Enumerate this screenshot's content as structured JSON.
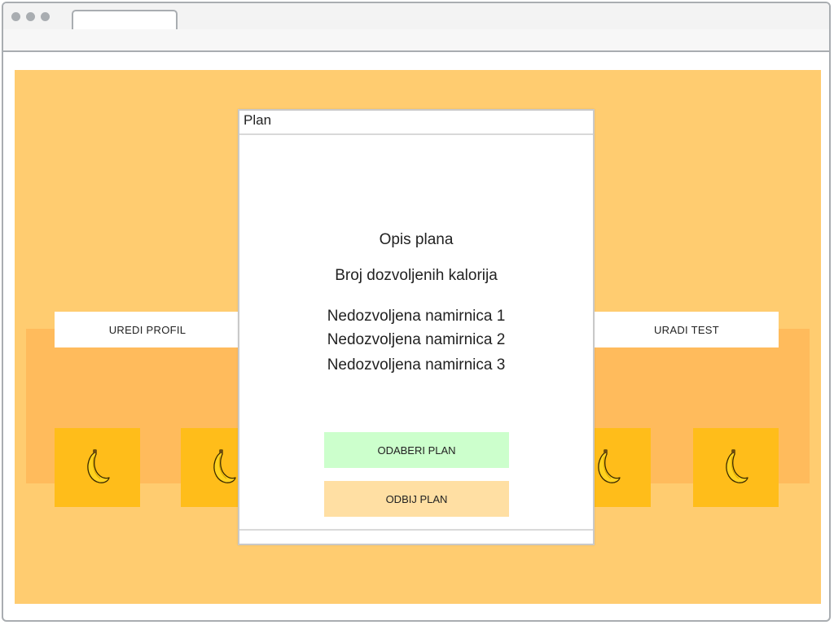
{
  "browser": {
    "window_controls": [
      "close-dot",
      "minimize-dot",
      "maximize-dot"
    ],
    "tab_title": ""
  },
  "nav": {
    "edit_profile": "UREDI PROFIL",
    "take_test": "URADI TEST"
  },
  "tiles": {
    "icon": "banana-icon",
    "count": 6
  },
  "modal": {
    "title": "Plan",
    "description": "Opis plana",
    "calories": "Broj dozvoljenih kalorija",
    "forbidden": [
      "Nedozvoljena namirnica 1",
      "Nedozvoljena namirnica 2",
      "Nedozvoljena namirnica 3"
    ],
    "accept_label": "ODABERI PLAN",
    "reject_label": "ODBIJ PLAN"
  },
  "colors": {
    "page_bg": "#ffcc70",
    "panel_bg": "#ffbb5c",
    "tile_bg": "#ffbd1a",
    "accept_bg": "#ccffcc",
    "reject_bg": "#ffdfa3"
  }
}
